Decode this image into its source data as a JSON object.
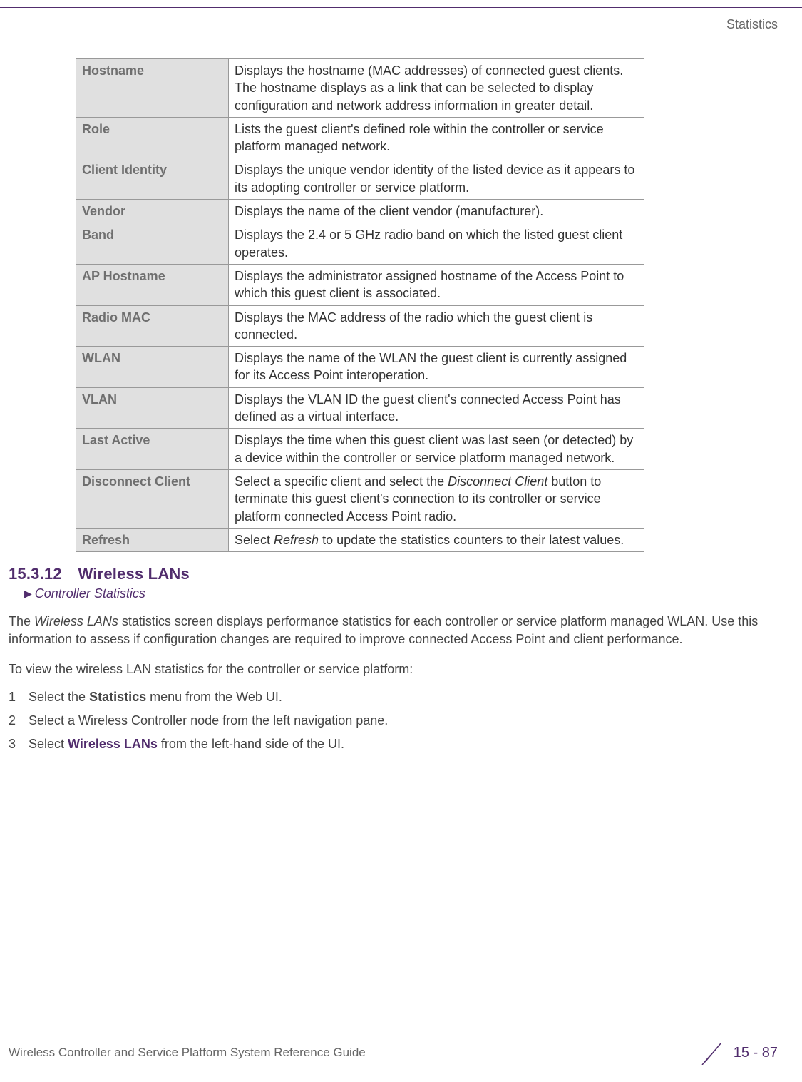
{
  "runningHead": "Statistics",
  "table": {
    "rows": [
      {
        "key": "Hostname",
        "val": "Displays the hostname (MAC addresses) of connected guest clients. The hostname displays as a link that can be selected to display configuration and network address information in greater detail."
      },
      {
        "key": "Role",
        "val": "Lists the guest client's defined role within the controller or service platform managed network."
      },
      {
        "key": "Client Identity",
        "val": "Displays the unique vendor identity of the listed device as it appears to its adopting controller or service platform."
      },
      {
        "key": "Vendor",
        "val": "Displays the name of the client vendor (manufacturer)."
      },
      {
        "key": "Band",
        "val": "Displays the 2.4 or 5 GHz radio band on which the listed guest client operates."
      },
      {
        "key": "AP Hostname",
        "val": "Displays the administrator assigned hostname of the Access Point to which this guest client is associated."
      },
      {
        "key": "Radio MAC",
        "val": "Displays the MAC address of the radio which the guest client is connected."
      },
      {
        "key": "WLAN",
        "val": "Displays the name of the WLAN the guest client is currently assigned for its Access Point interoperation."
      },
      {
        "key": "VLAN",
        "val": "Displays the VLAN ID the guest client's connected Access Point has defined as a virtual interface."
      },
      {
        "key": "Last Active",
        "val": "Displays the time when this guest client was last seen (or detected) by a device within the controller or service platform managed network."
      },
      {
        "key": "Disconnect Client",
        "val_pre": "Select a specific client and select the ",
        "val_em": "Disconnect Client",
        "val_post": " button to terminate this guest client's connection to its controller or service platform connected Access Point radio."
      },
      {
        "key": "Refresh",
        "val_pre": "Select ",
        "val_em": "Refresh",
        "val_post": " to update the statistics counters to their latest values."
      }
    ]
  },
  "section": {
    "number": "15.3.12",
    "title": "Wireless LANs",
    "breadcrumb": "Controller Statistics"
  },
  "para_parts": {
    "p1a": "The ",
    "p1em": "Wireless LANs",
    "p1b": " statistics screen displays performance statistics for each controller or service platform managed WLAN. Use this information to assess if configuration changes are required to improve connected Access Point and client performance.",
    "p2": "To view the wireless LAN statistics for the controller or service platform:"
  },
  "steps": {
    "s1a": "Select the ",
    "s1b_bold": "Statistics",
    "s1c": " menu from the Web UI.",
    "s2": "Select a Wireless Controller node from the left navigation pane.",
    "s3a": "Select ",
    "s3b_purple": "Wireless LANs",
    "s3c": " from the left-hand side of the UI."
  },
  "footer": {
    "left": "Wireless Controller and Service Platform System Reference Guide",
    "right": "15 - 87"
  }
}
